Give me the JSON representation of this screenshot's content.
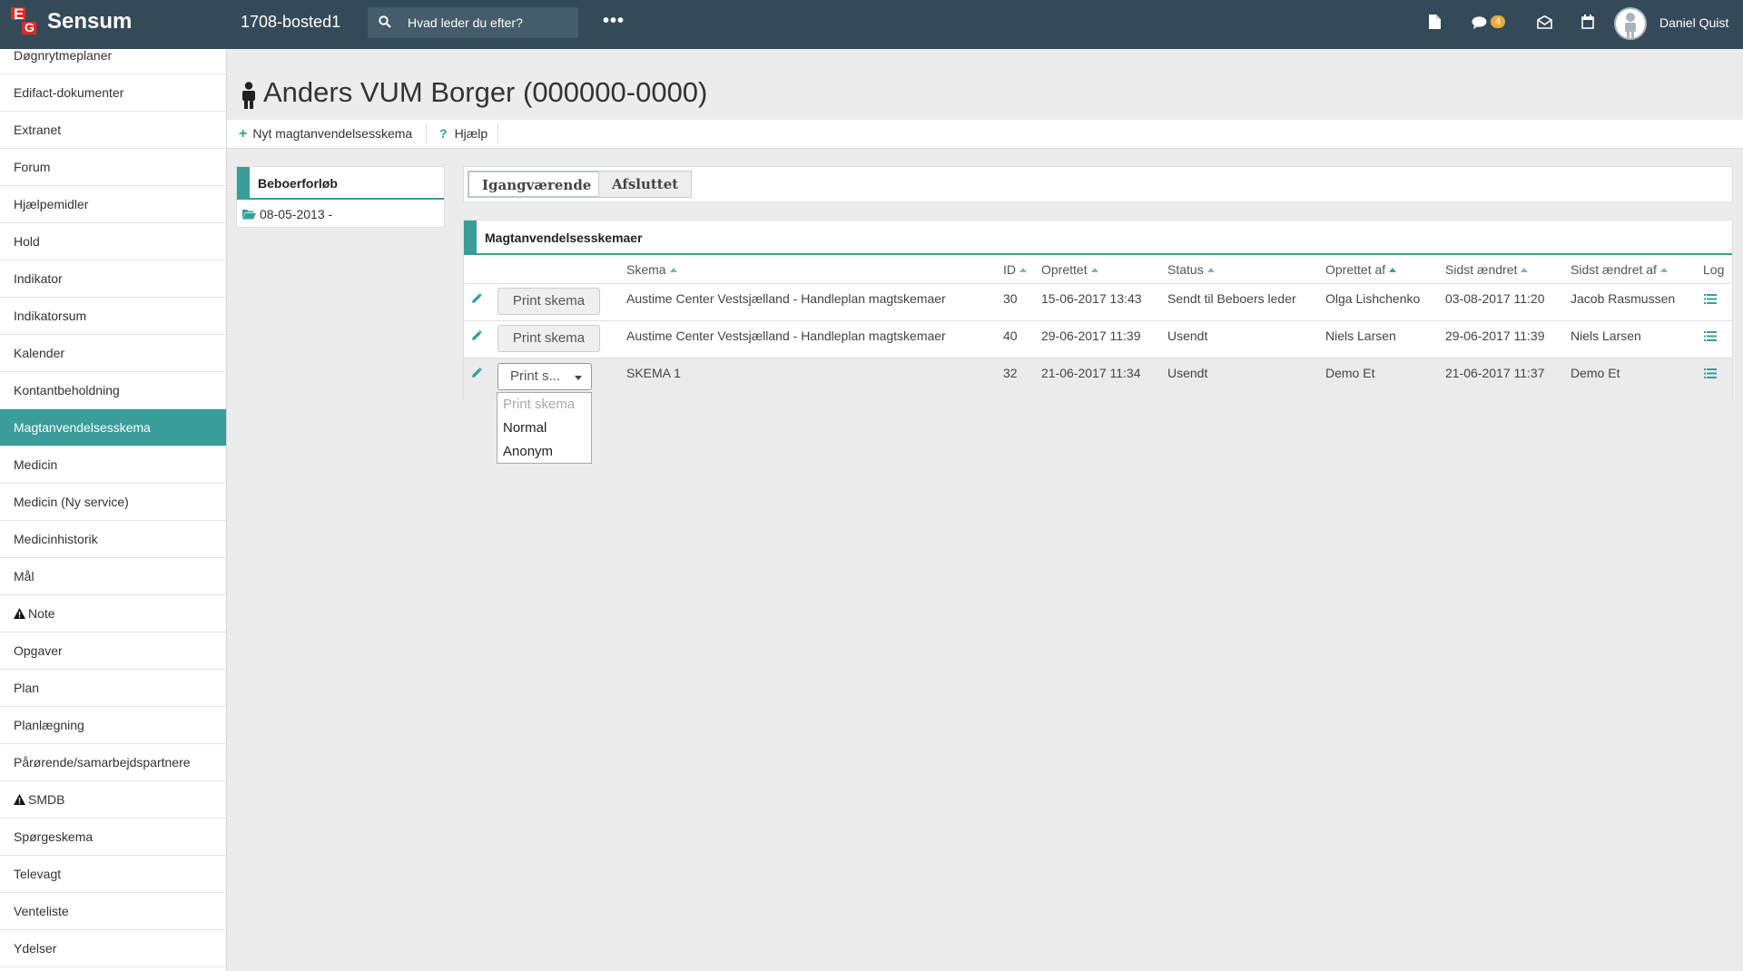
{
  "topbar": {
    "brand": "Sensum",
    "logo_letters": [
      "E",
      "G"
    ],
    "project": "1708-bosted1",
    "search_placeholder": "Hvad leder du efter?",
    "more_label": "•••",
    "message_count": "4",
    "user_name": "Daniel Quist",
    "icons": [
      "search-icon",
      "more-icon",
      "document-icon",
      "chat-icon",
      "mail-icon",
      "calendar-icon",
      "user-avatar"
    ]
  },
  "sidebar": {
    "items": [
      {
        "label": "Døgnrytmeplaner"
      },
      {
        "label": "Edifact-dokumenter"
      },
      {
        "label": "Extranet"
      },
      {
        "label": "Forum"
      },
      {
        "label": "Hjælpemidler"
      },
      {
        "label": "Hold"
      },
      {
        "label": "Indikator"
      },
      {
        "label": "Indikatorsum"
      },
      {
        "label": "Kalender"
      },
      {
        "label": "Kontantbeholdning"
      },
      {
        "label": "Magtanvendelsesskema",
        "active": true
      },
      {
        "label": "Medicin"
      },
      {
        "label": "Medicin (Ny service)"
      },
      {
        "label": "Medicinhistorik"
      },
      {
        "label": "Mål"
      },
      {
        "label": "Note",
        "warning": true
      },
      {
        "label": "Opgaver"
      },
      {
        "label": "Plan"
      },
      {
        "label": "Planlægning"
      },
      {
        "label": "Pårørende/samarbejdspartnere"
      },
      {
        "label": "SMDB",
        "warning": true
      },
      {
        "label": "Spørgeskema"
      },
      {
        "label": "Televagt"
      },
      {
        "label": "Venteliste"
      },
      {
        "label": "Ydelser"
      }
    ]
  },
  "page": {
    "title": "Anders VUM Borger (000000-0000)",
    "actions": {
      "new": "Nyt magtanvendelsesskema",
      "help": "Hjælp"
    }
  },
  "beboerforlob": {
    "title": "Beboerforløb",
    "entry": "08-05-2013 -"
  },
  "tabs": [
    {
      "label": "Igangværende",
      "active": true
    },
    {
      "label": "Afsluttet",
      "active": false
    }
  ],
  "table": {
    "title": "Magtanvendelsesskemaer",
    "headers": {
      "skema": "Skema",
      "id": "ID",
      "oprettet": "Oprettet",
      "status": "Status",
      "oprettet_af": "Oprettet af",
      "sidst_aendret": "Sidst ændret",
      "sidst_aendret_af": "Sidst ændret af",
      "log": "Log"
    },
    "rows": [
      {
        "button": "Print skema",
        "skema": "Austime Center Vestsjælland - Handleplan magtskemaer",
        "id": "30",
        "oprettet": "15-06-2017 13:43",
        "status": "Sendt til Beboers leder",
        "oprettet_af": "Olga Lishchenko",
        "sidst_aendret": "03-08-2017 11:20",
        "sidst_aendret_af": "Jacob Rasmussen"
      },
      {
        "button": "Print skema",
        "skema": "Austime Center Vestsjælland - Handleplan magtskemaer",
        "id": "40",
        "oprettet": "29-06-2017 11:39",
        "status": "Usendt",
        "oprettet_af": "Niels Larsen",
        "sidst_aendret": "29-06-2017 11:39",
        "sidst_aendret_af": "Niels Larsen"
      },
      {
        "button": "Print s...",
        "skema": "SKEMA 1",
        "id": "32",
        "oprettet": "21-06-2017 11:34",
        "status": "Usendt",
        "oprettet_af": "Demo Et",
        "sidst_aendret": "21-06-2017 11:37",
        "sidst_aendret_af": "Demo Et"
      }
    ]
  },
  "dropdown": {
    "placeholder": "Print skema",
    "options": [
      "Normal",
      "Anonym"
    ]
  },
  "colors": {
    "topbar": "#344a58",
    "accent": "#3a9d9a",
    "logo_red": "#e32925",
    "badge": "#f0a838"
  }
}
